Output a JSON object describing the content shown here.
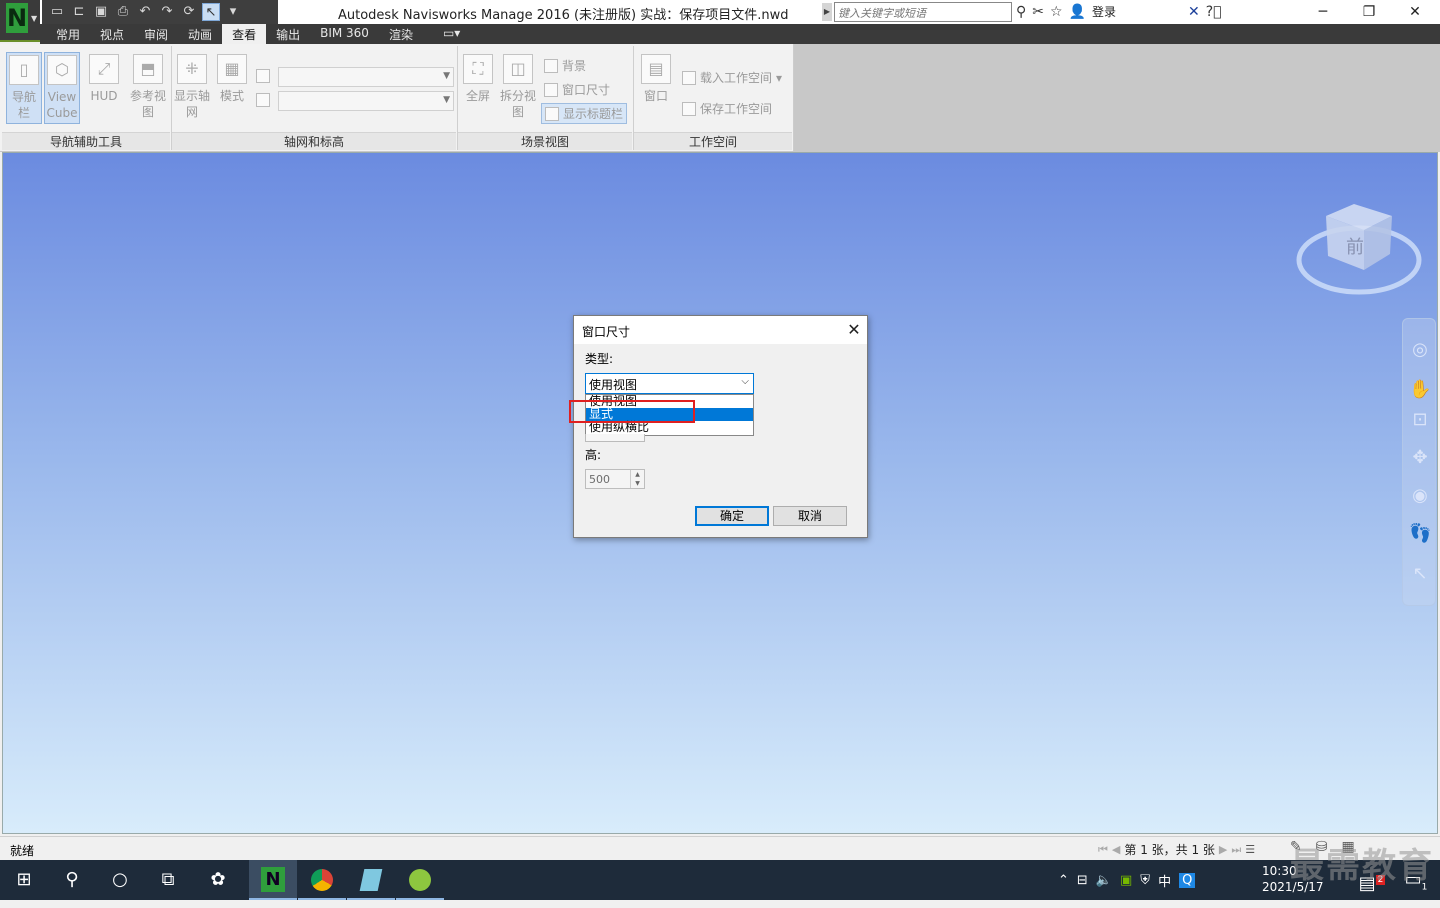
{
  "titlebar": {
    "title": "Autodesk Navisworks Manage 2016 (未注册版)    实战：保存项目文件.nwd",
    "search_placeholder": "键入关键字或短语",
    "login": "登录",
    "app_letter": "N"
  },
  "tabs": [
    "常用",
    "视点",
    "审阅",
    "动画",
    "查看",
    "输出",
    "BIM 360",
    "渲染"
  ],
  "active_tab": "查看",
  "ribbon": {
    "nav_bar_btn": "导航栏",
    "viewcube_btn": "View Cube",
    "hud_btn": "HUD",
    "ref_view_btn": "参考视图",
    "show_grid_btn": "显示轴网",
    "mode_btn": "模式",
    "fullscreen_btn": "全屏",
    "split_view_btn": "拆分视图",
    "background_btn": "背景",
    "window_size_btn": "窗口尺寸",
    "show_titlebar_btn": "显示标题栏",
    "window_btn": "窗口",
    "load_workspace_btn": "载入工作空间",
    "save_workspace_btn": "保存工作空间",
    "panel_nav": "导航辅助工具",
    "panel_grid": "轴网和标高",
    "panel_scene": "场景视图",
    "panel_workspace": "工作空间"
  },
  "viewcube_face": "前",
  "dialog": {
    "title": "窗口尺寸",
    "type_label": "类型:",
    "type_value": "使用视图",
    "options": [
      "使用视图",
      "显式",
      "使用纵横比"
    ],
    "highlighted_option": "显式",
    "height_label": "高:",
    "height_value": "500",
    "ok": "确定",
    "cancel": "取消"
  },
  "statusbar": {
    "status": "就绪",
    "sheet": "第 1 张，共 1 张"
  },
  "taskbar": {
    "ime": "中",
    "time": "10:30",
    "date": "2021/5/17",
    "notification_count": "2",
    "action_center_count": "1"
  },
  "watermark": "最需教育"
}
